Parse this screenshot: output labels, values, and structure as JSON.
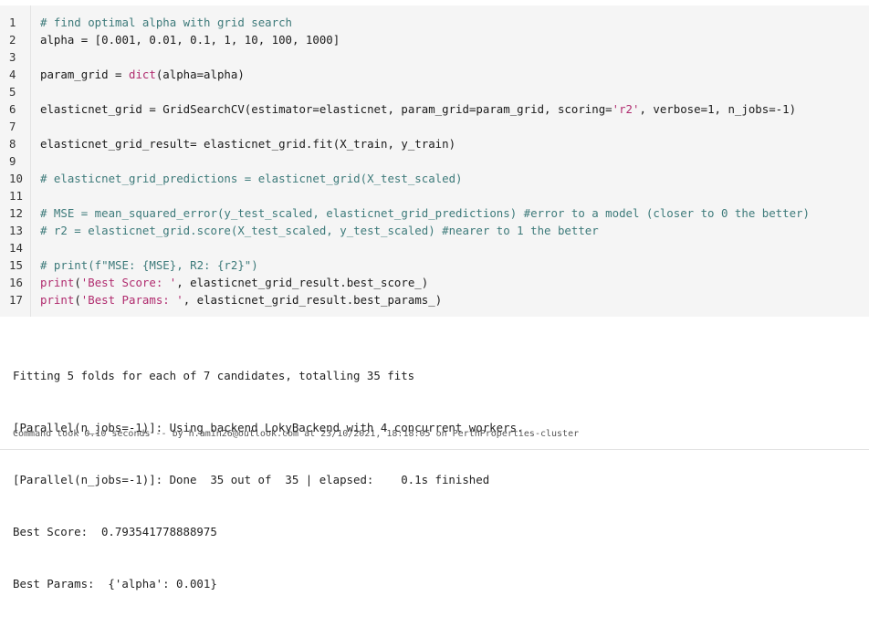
{
  "code_lines": [
    {
      "n": "1",
      "parts": [
        {
          "t": "# find optimal alpha with grid search",
          "c": "cm"
        }
      ]
    },
    {
      "n": "2",
      "parts": [
        {
          "t": "alpha = [0.001, 0.01, 0.1, 1, 10, 100, 1000]",
          "c": ""
        }
      ]
    },
    {
      "n": "3",
      "parts": []
    },
    {
      "n": "4",
      "parts": [
        {
          "t": "param_grid = ",
          "c": ""
        },
        {
          "t": "dict",
          "c": "fn"
        },
        {
          "t": "(alpha=alpha)",
          "c": ""
        }
      ]
    },
    {
      "n": "5",
      "parts": []
    },
    {
      "n": "6",
      "parts": [
        {
          "t": "elasticnet_grid = GridSearchCV(estimator=elasticnet, param_grid=param_grid, scoring=",
          "c": ""
        },
        {
          "t": "'r2'",
          "c": "str"
        },
        {
          "t": ", verbose=1, n_jobs=-1)",
          "c": ""
        }
      ]
    },
    {
      "n": "7",
      "parts": []
    },
    {
      "n": "8",
      "parts": [
        {
          "t": "elasticnet_grid_result= elasticnet_grid.fit(X_train, y_train)",
          "c": ""
        }
      ]
    },
    {
      "n": "9",
      "parts": []
    },
    {
      "n": "10",
      "parts": [
        {
          "t": "# elasticnet_grid_predictions = elasticnet_grid(X_test_scaled)",
          "c": "cm"
        }
      ]
    },
    {
      "n": "11",
      "parts": []
    },
    {
      "n": "12",
      "parts": [
        {
          "t": "# MSE = mean_squared_error(y_test_scaled, elasticnet_grid_predictions) #error to a model (closer to 0 the better)",
          "c": "cm"
        }
      ]
    },
    {
      "n": "13",
      "parts": [
        {
          "t": "# r2 = elasticnet_grid.score(X_test_scaled, y_test_scaled) #nearer to 1 the better",
          "c": "cm"
        }
      ]
    },
    {
      "n": "14",
      "parts": []
    },
    {
      "n": "15",
      "parts": [
        {
          "t": "# print(f\"MSE: {MSE}, R2: {r2}\")",
          "c": "cm"
        }
      ]
    },
    {
      "n": "16",
      "parts": [
        {
          "t": "print",
          "c": "fn"
        },
        {
          "t": "(",
          "c": ""
        },
        {
          "t": "'Best Score: '",
          "c": "str"
        },
        {
          "t": ", elasticnet_grid_result.best_score_)",
          "c": ""
        }
      ]
    },
    {
      "n": "17",
      "parts": [
        {
          "t": "print",
          "c": "fn"
        },
        {
          "t": "(",
          "c": ""
        },
        {
          "t": "'Best Params: '",
          "c": "str"
        },
        {
          "t": ", elasticnet_grid_result.best_params_)",
          "c": ""
        }
      ]
    }
  ],
  "output_lines": [
    "Fitting 5 folds for each of 7 candidates, totalling 35 fits",
    "[Parallel(n_jobs=-1)]: Using backend LokyBackend with 4 concurrent workers.",
    "[Parallel(n_jobs=-1)]: Done  35 out of  35 | elapsed:    0.1s finished",
    "Best Score:  0.793541778888975",
    "Best Params:  {'alpha': 0.001}"
  ],
  "footer": "Command took 0.10 seconds -- by h.amin26@outlook.com at 23/10/2021, 18:18:05 on PerthProperties-cluster"
}
